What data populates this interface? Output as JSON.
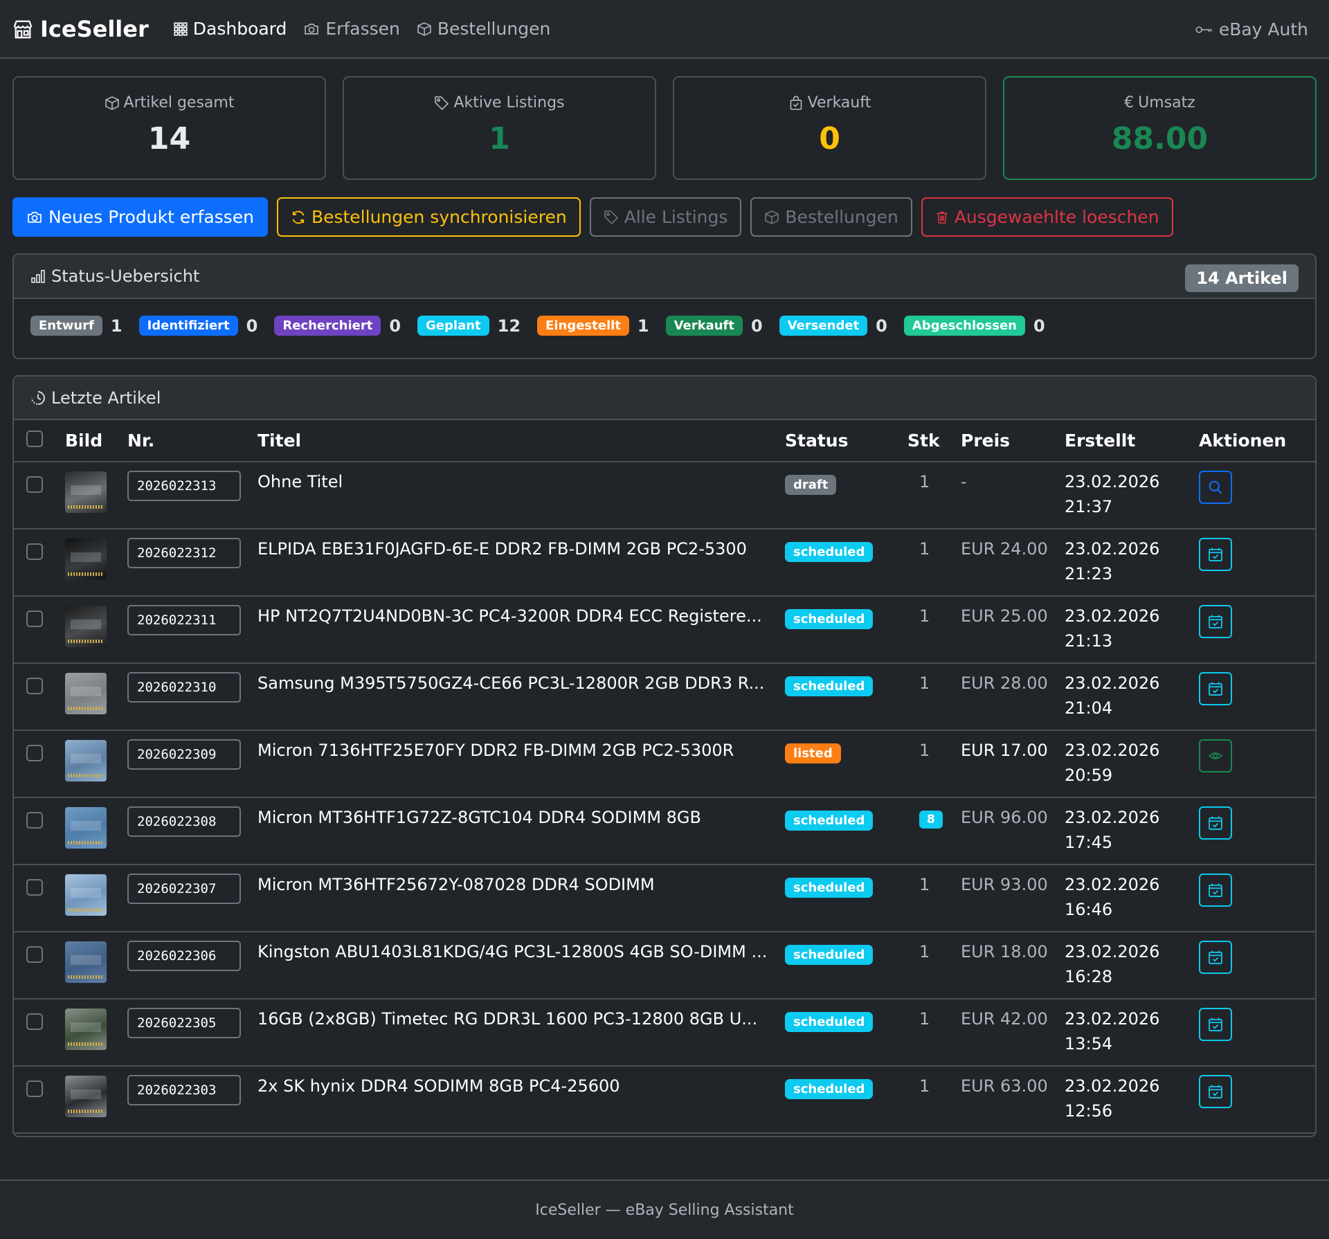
{
  "nav": {
    "brand": "IceSeller",
    "links": [
      "Dashboard",
      "Erfassen",
      "Bestellungen"
    ],
    "auth": "eBay Auth"
  },
  "stats": [
    {
      "label": "Artikel gesamt",
      "value": "14",
      "color": "#e9ecef",
      "icon": "box-icon"
    },
    {
      "label": "Aktive Listings",
      "value": "1",
      "color": "#198754",
      "icon": "tag-icon"
    },
    {
      "label": "Verkauft",
      "value": "0",
      "color": "#ffc107",
      "icon": "bag-check-icon"
    },
    {
      "label": "Umsatz",
      "value": "88.00",
      "color": "#198754",
      "icon": "euro-icon",
      "symbol": "€"
    }
  ],
  "buttons": {
    "new_product": "Neues Produkt erfassen",
    "sync_orders": "Bestellungen synchronisieren",
    "all_listings": "Alle Listings",
    "orders": "Bestellungen",
    "delete_selected": "Ausgewaehlte loeschen"
  },
  "status_overview": {
    "title": "Status-Uebersicht",
    "count_label": "14 Artikel",
    "items": [
      {
        "label": "Entwurf",
        "count": "1",
        "color": "#6c757d"
      },
      {
        "label": "Identifiziert",
        "count": "0",
        "color": "#0d6efd"
      },
      {
        "label": "Recherchiert",
        "count": "0",
        "color": "#6f42c1"
      },
      {
        "label": "Geplant",
        "count": "12",
        "color": "#0dcaf0"
      },
      {
        "label": "Eingestellt",
        "count": "1",
        "color": "#fd7e14"
      },
      {
        "label": "Verkauft",
        "count": "0",
        "color": "#198754"
      },
      {
        "label": "Versendet",
        "count": "0",
        "color": "#0dcaf0"
      },
      {
        "label": "Abgeschlossen",
        "count": "0",
        "color": "#20c997"
      }
    ]
  },
  "recent": {
    "title": "Letzte Artikel",
    "headers": [
      "Bild",
      "Nr.",
      "Titel",
      "Status",
      "Stk",
      "Preis",
      "Erstellt",
      "Aktionen"
    ],
    "rows": [
      {
        "nr": "2026022313",
        "title": "Ohne Titel",
        "status": "draft",
        "status_color": "#6c757d",
        "stk": "1",
        "preis": "-",
        "date": "23.02.2026",
        "time": "21:37",
        "action": "search-icon"
      },
      {
        "nr": "2026022312",
        "title": "ELPIDA EBE31F0JAGFD-6E-E DDR2 FB-DIMM 2GB PC2-5300",
        "status": "scheduled",
        "status_color": "#0dcaf0",
        "stk": "1",
        "preis": "EUR 24.00",
        "date": "23.02.2026",
        "time": "21:23",
        "action": "calendar-check-icon"
      },
      {
        "nr": "2026022311",
        "title": "HP NT2Q7T2U4ND0BN-3C PC4-3200R DDR4 ECC Registere...",
        "status": "scheduled",
        "status_color": "#0dcaf0",
        "stk": "1",
        "preis": "EUR 25.00",
        "date": "23.02.2026",
        "time": "21:13",
        "action": "calendar-check-icon"
      },
      {
        "nr": "2026022310",
        "title": "Samsung M395T5750GZ4-CE66 PC3L-12800R 2GB DDR3 R...",
        "status": "scheduled",
        "status_color": "#0dcaf0",
        "stk": "1",
        "preis": "EUR 28.00",
        "date": "23.02.2026",
        "time": "21:04",
        "action": "calendar-check-icon"
      },
      {
        "nr": "2026022309",
        "title": "Micron 7136HTF25E70FY DDR2 FB-DIMM 2GB PC2-5300R",
        "status": "listed",
        "status_color": "#fd7e14",
        "stk": "1",
        "preis": "EUR 17.00",
        "date": "23.02.2026",
        "time": "20:59",
        "action": "eye-icon"
      },
      {
        "nr": "2026022308",
        "title": "Micron MT36HTF1G72Z-8GTC104 DDR4 SODIMM 8GB",
        "status": "scheduled",
        "status_color": "#0dcaf0",
        "stk": "8",
        "preis": "EUR 96.00",
        "date": "23.02.2026",
        "time": "17:45",
        "action": "calendar-check-icon"
      },
      {
        "nr": "2026022307",
        "title": "Micron MT36HTF25672Y-087028 DDR4 SODIMM",
        "status": "scheduled",
        "status_color": "#0dcaf0",
        "stk": "1",
        "preis": "EUR 93.00",
        "date": "23.02.2026",
        "time": "16:46",
        "action": "calendar-check-icon"
      },
      {
        "nr": "2026022306",
        "title": "Kingston ABU1403L81KDG/4G PC3L-12800S 4GB SO-DIMM ...",
        "status": "scheduled",
        "status_color": "#0dcaf0",
        "stk": "1",
        "preis": "EUR 18.00",
        "date": "23.02.2026",
        "time": "16:28",
        "action": "calendar-check-icon"
      },
      {
        "nr": "2026022305",
        "title": "16GB (2x8GB) Timetec RG DDR3L 1600 PC3-12800 8GB U...",
        "status": "scheduled",
        "status_color": "#0dcaf0",
        "stk": "1",
        "preis": "EUR 42.00",
        "date": "23.02.2026",
        "time": "13:54",
        "action": "calendar-check-icon"
      },
      {
        "nr": "2026022303",
        "title": "2x SK hynix DDR4 SODIMM 8GB PC4-25600",
        "status": "scheduled",
        "status_color": "#0dcaf0",
        "stk": "1",
        "preis": "EUR 63.00",
        "date": "23.02.2026",
        "time": "12:56",
        "action": "calendar-check-icon"
      }
    ]
  },
  "footer": "IceSeller — eBay Selling Assistant"
}
